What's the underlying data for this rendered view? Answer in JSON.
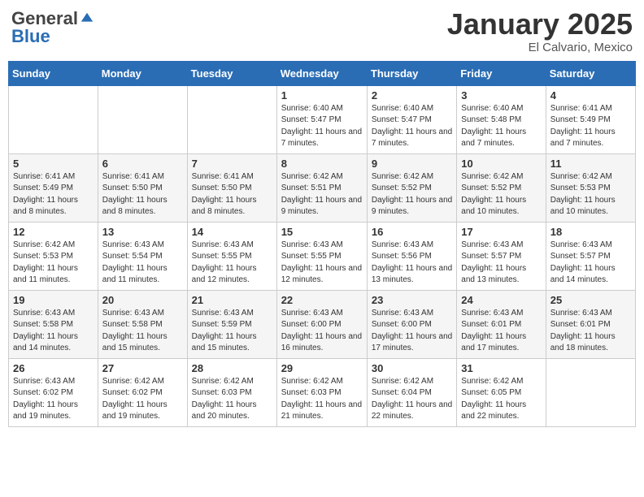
{
  "logo": {
    "general": "General",
    "blue": "Blue"
  },
  "header": {
    "month_year": "January 2025",
    "location": "El Calvario, Mexico"
  },
  "days_of_week": [
    "Sunday",
    "Monday",
    "Tuesday",
    "Wednesday",
    "Thursday",
    "Friday",
    "Saturday"
  ],
  "weeks": [
    [
      {
        "day": "",
        "info": ""
      },
      {
        "day": "",
        "info": ""
      },
      {
        "day": "",
        "info": ""
      },
      {
        "day": "1",
        "info": "Sunrise: 6:40 AM\nSunset: 5:47 PM\nDaylight: 11 hours and 7 minutes."
      },
      {
        "day": "2",
        "info": "Sunrise: 6:40 AM\nSunset: 5:47 PM\nDaylight: 11 hours and 7 minutes."
      },
      {
        "day": "3",
        "info": "Sunrise: 6:40 AM\nSunset: 5:48 PM\nDaylight: 11 hours and 7 minutes."
      },
      {
        "day": "4",
        "info": "Sunrise: 6:41 AM\nSunset: 5:49 PM\nDaylight: 11 hours and 7 minutes."
      }
    ],
    [
      {
        "day": "5",
        "info": "Sunrise: 6:41 AM\nSunset: 5:49 PM\nDaylight: 11 hours and 8 minutes."
      },
      {
        "day": "6",
        "info": "Sunrise: 6:41 AM\nSunset: 5:50 PM\nDaylight: 11 hours and 8 minutes."
      },
      {
        "day": "7",
        "info": "Sunrise: 6:41 AM\nSunset: 5:50 PM\nDaylight: 11 hours and 8 minutes."
      },
      {
        "day": "8",
        "info": "Sunrise: 6:42 AM\nSunset: 5:51 PM\nDaylight: 11 hours and 9 minutes."
      },
      {
        "day": "9",
        "info": "Sunrise: 6:42 AM\nSunset: 5:52 PM\nDaylight: 11 hours and 9 minutes."
      },
      {
        "day": "10",
        "info": "Sunrise: 6:42 AM\nSunset: 5:52 PM\nDaylight: 11 hours and 10 minutes."
      },
      {
        "day": "11",
        "info": "Sunrise: 6:42 AM\nSunset: 5:53 PM\nDaylight: 11 hours and 10 minutes."
      }
    ],
    [
      {
        "day": "12",
        "info": "Sunrise: 6:42 AM\nSunset: 5:53 PM\nDaylight: 11 hours and 11 minutes."
      },
      {
        "day": "13",
        "info": "Sunrise: 6:43 AM\nSunset: 5:54 PM\nDaylight: 11 hours and 11 minutes."
      },
      {
        "day": "14",
        "info": "Sunrise: 6:43 AM\nSunset: 5:55 PM\nDaylight: 11 hours and 12 minutes."
      },
      {
        "day": "15",
        "info": "Sunrise: 6:43 AM\nSunset: 5:55 PM\nDaylight: 11 hours and 12 minutes."
      },
      {
        "day": "16",
        "info": "Sunrise: 6:43 AM\nSunset: 5:56 PM\nDaylight: 11 hours and 13 minutes."
      },
      {
        "day": "17",
        "info": "Sunrise: 6:43 AM\nSunset: 5:57 PM\nDaylight: 11 hours and 13 minutes."
      },
      {
        "day": "18",
        "info": "Sunrise: 6:43 AM\nSunset: 5:57 PM\nDaylight: 11 hours and 14 minutes."
      }
    ],
    [
      {
        "day": "19",
        "info": "Sunrise: 6:43 AM\nSunset: 5:58 PM\nDaylight: 11 hours and 14 minutes."
      },
      {
        "day": "20",
        "info": "Sunrise: 6:43 AM\nSunset: 5:58 PM\nDaylight: 11 hours and 15 minutes."
      },
      {
        "day": "21",
        "info": "Sunrise: 6:43 AM\nSunset: 5:59 PM\nDaylight: 11 hours and 15 minutes."
      },
      {
        "day": "22",
        "info": "Sunrise: 6:43 AM\nSunset: 6:00 PM\nDaylight: 11 hours and 16 minutes."
      },
      {
        "day": "23",
        "info": "Sunrise: 6:43 AM\nSunset: 6:00 PM\nDaylight: 11 hours and 17 minutes."
      },
      {
        "day": "24",
        "info": "Sunrise: 6:43 AM\nSunset: 6:01 PM\nDaylight: 11 hours and 17 minutes."
      },
      {
        "day": "25",
        "info": "Sunrise: 6:43 AM\nSunset: 6:01 PM\nDaylight: 11 hours and 18 minutes."
      }
    ],
    [
      {
        "day": "26",
        "info": "Sunrise: 6:43 AM\nSunset: 6:02 PM\nDaylight: 11 hours and 19 minutes."
      },
      {
        "day": "27",
        "info": "Sunrise: 6:42 AM\nSunset: 6:02 PM\nDaylight: 11 hours and 19 minutes."
      },
      {
        "day": "28",
        "info": "Sunrise: 6:42 AM\nSunset: 6:03 PM\nDaylight: 11 hours and 20 minutes."
      },
      {
        "day": "29",
        "info": "Sunrise: 6:42 AM\nSunset: 6:03 PM\nDaylight: 11 hours and 21 minutes."
      },
      {
        "day": "30",
        "info": "Sunrise: 6:42 AM\nSunset: 6:04 PM\nDaylight: 11 hours and 22 minutes."
      },
      {
        "day": "31",
        "info": "Sunrise: 6:42 AM\nSunset: 6:05 PM\nDaylight: 11 hours and 22 minutes."
      },
      {
        "day": "",
        "info": ""
      }
    ]
  ]
}
